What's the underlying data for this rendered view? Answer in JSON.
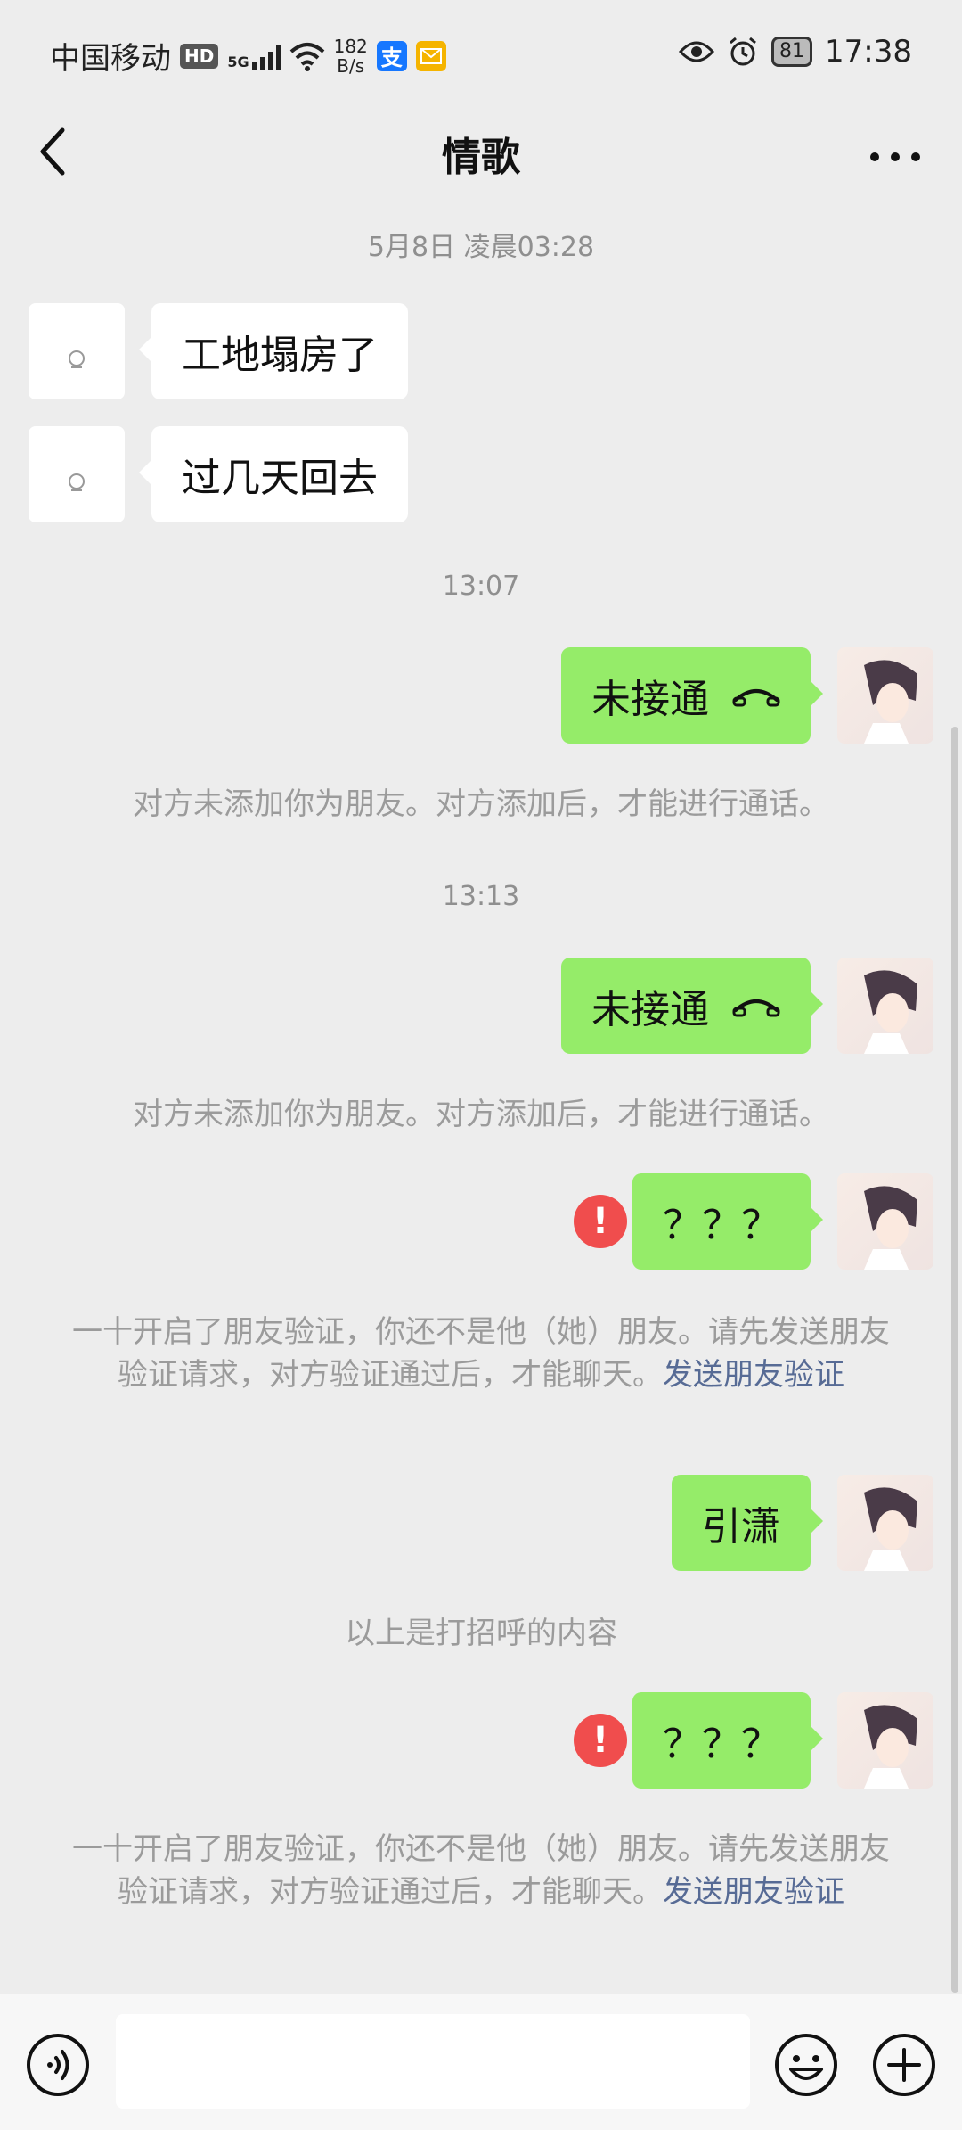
{
  "status_bar": {
    "carrier": "中国移动",
    "hd": "HD",
    "network": "5G",
    "speed_value": "182",
    "speed_unit": "B/s",
    "alipay_glyph": "支",
    "battery": "81",
    "time": "17:38"
  },
  "header": {
    "title": "情歌"
  },
  "messages": {
    "t1": "5月8日 凌晨03:28",
    "m1": "工地塌房了",
    "m2": "过几天回去",
    "t2": "13:07",
    "call1": "未接通",
    "sys1": "对方未添加你为朋友。对方添加后，才能进行通话。",
    "t3": "13:13",
    "call2": "未接通",
    "sys2": "对方未添加你为朋友。对方添加后，才能进行通话。",
    "q1": "？？？",
    "verify1_text": "一十开启了朋友验证，你还不是他（她）朋友。请先发送朋友验证请求，对方验证通过后，才能聊天。",
    "verify1_link": "发送朋友验证",
    "m3": "引潇",
    "sys3": "以上是打招呼的内容",
    "q2": "？？？",
    "verify2_text": "一十开启了朋友验证，你还不是他（她）朋友。请先发送朋友验证请求，对方验证通过后，才能聊天。",
    "verify2_link": "发送朋友验证",
    "error_mark": "!"
  },
  "input_bar": {
    "message_text": ""
  },
  "colors": {
    "background": "#ededed",
    "outgoing_bubble": "#95ec69",
    "incoming_bubble": "#ffffff",
    "link": "#576b95",
    "error": "#f04d4d"
  },
  "icons": [
    "back-arrow-icon",
    "more-icon",
    "phone-icon",
    "voice-icon",
    "emoji-icon",
    "plus-icon",
    "eye-icon",
    "alarm-icon",
    "wifi-icon",
    "alipay-icon",
    "mail-icon"
  ]
}
